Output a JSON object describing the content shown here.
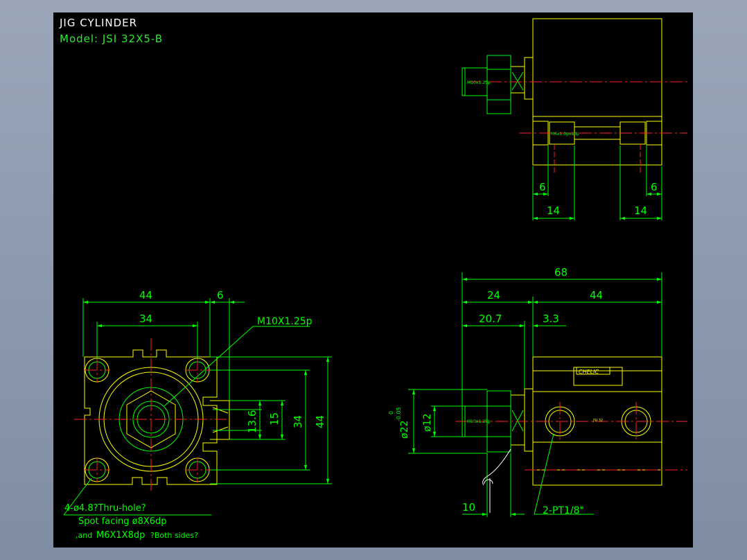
{
  "title": "JIG CYLINDER",
  "model": "Model: JSI 32X5-B",
  "colors": {
    "background": "#000000",
    "outline": "#ffff00",
    "dimension": "#00ff00",
    "center": "#ff2020",
    "text": "#ffffff"
  },
  "dims": {
    "top_left_6": "6",
    "top_right_6": "6",
    "top_left_14": "14",
    "top_right_14": "14",
    "front_44": "44",
    "front_6": "6",
    "front_34": "34",
    "front_thread": "M10X1.25p",
    "front_13_6": "13.6",
    "front_15": "15",
    "front_34v": "34",
    "front_44v": "44",
    "side_68": "68",
    "side_24": "24",
    "side_44": "44",
    "side_20_7": "20.7",
    "side_3_3": "3.3",
    "side_phi22": "ø22",
    "side_tol_top": "0",
    "side_tol_bot": "-0.05",
    "side_phi12": "ø12",
    "side_10": "10",
    "side_port": "2-PT1/8\""
  },
  "notes": {
    "line1": "4-ø4.8?Thru-hole?",
    "line2": "Spot facing ø8X6dp",
    "line3a": ",and",
    "line3b": "M6X1X8dp",
    "line3c": "?Both sides?"
  },
  "small_text": {
    "m10_top": "M10x1.25p",
    "m6_top": "M6x1.0px8dp",
    "m10_side": "M10x1.25p",
    "brand": "CHELIC",
    "jsi": "JSI 32"
  }
}
